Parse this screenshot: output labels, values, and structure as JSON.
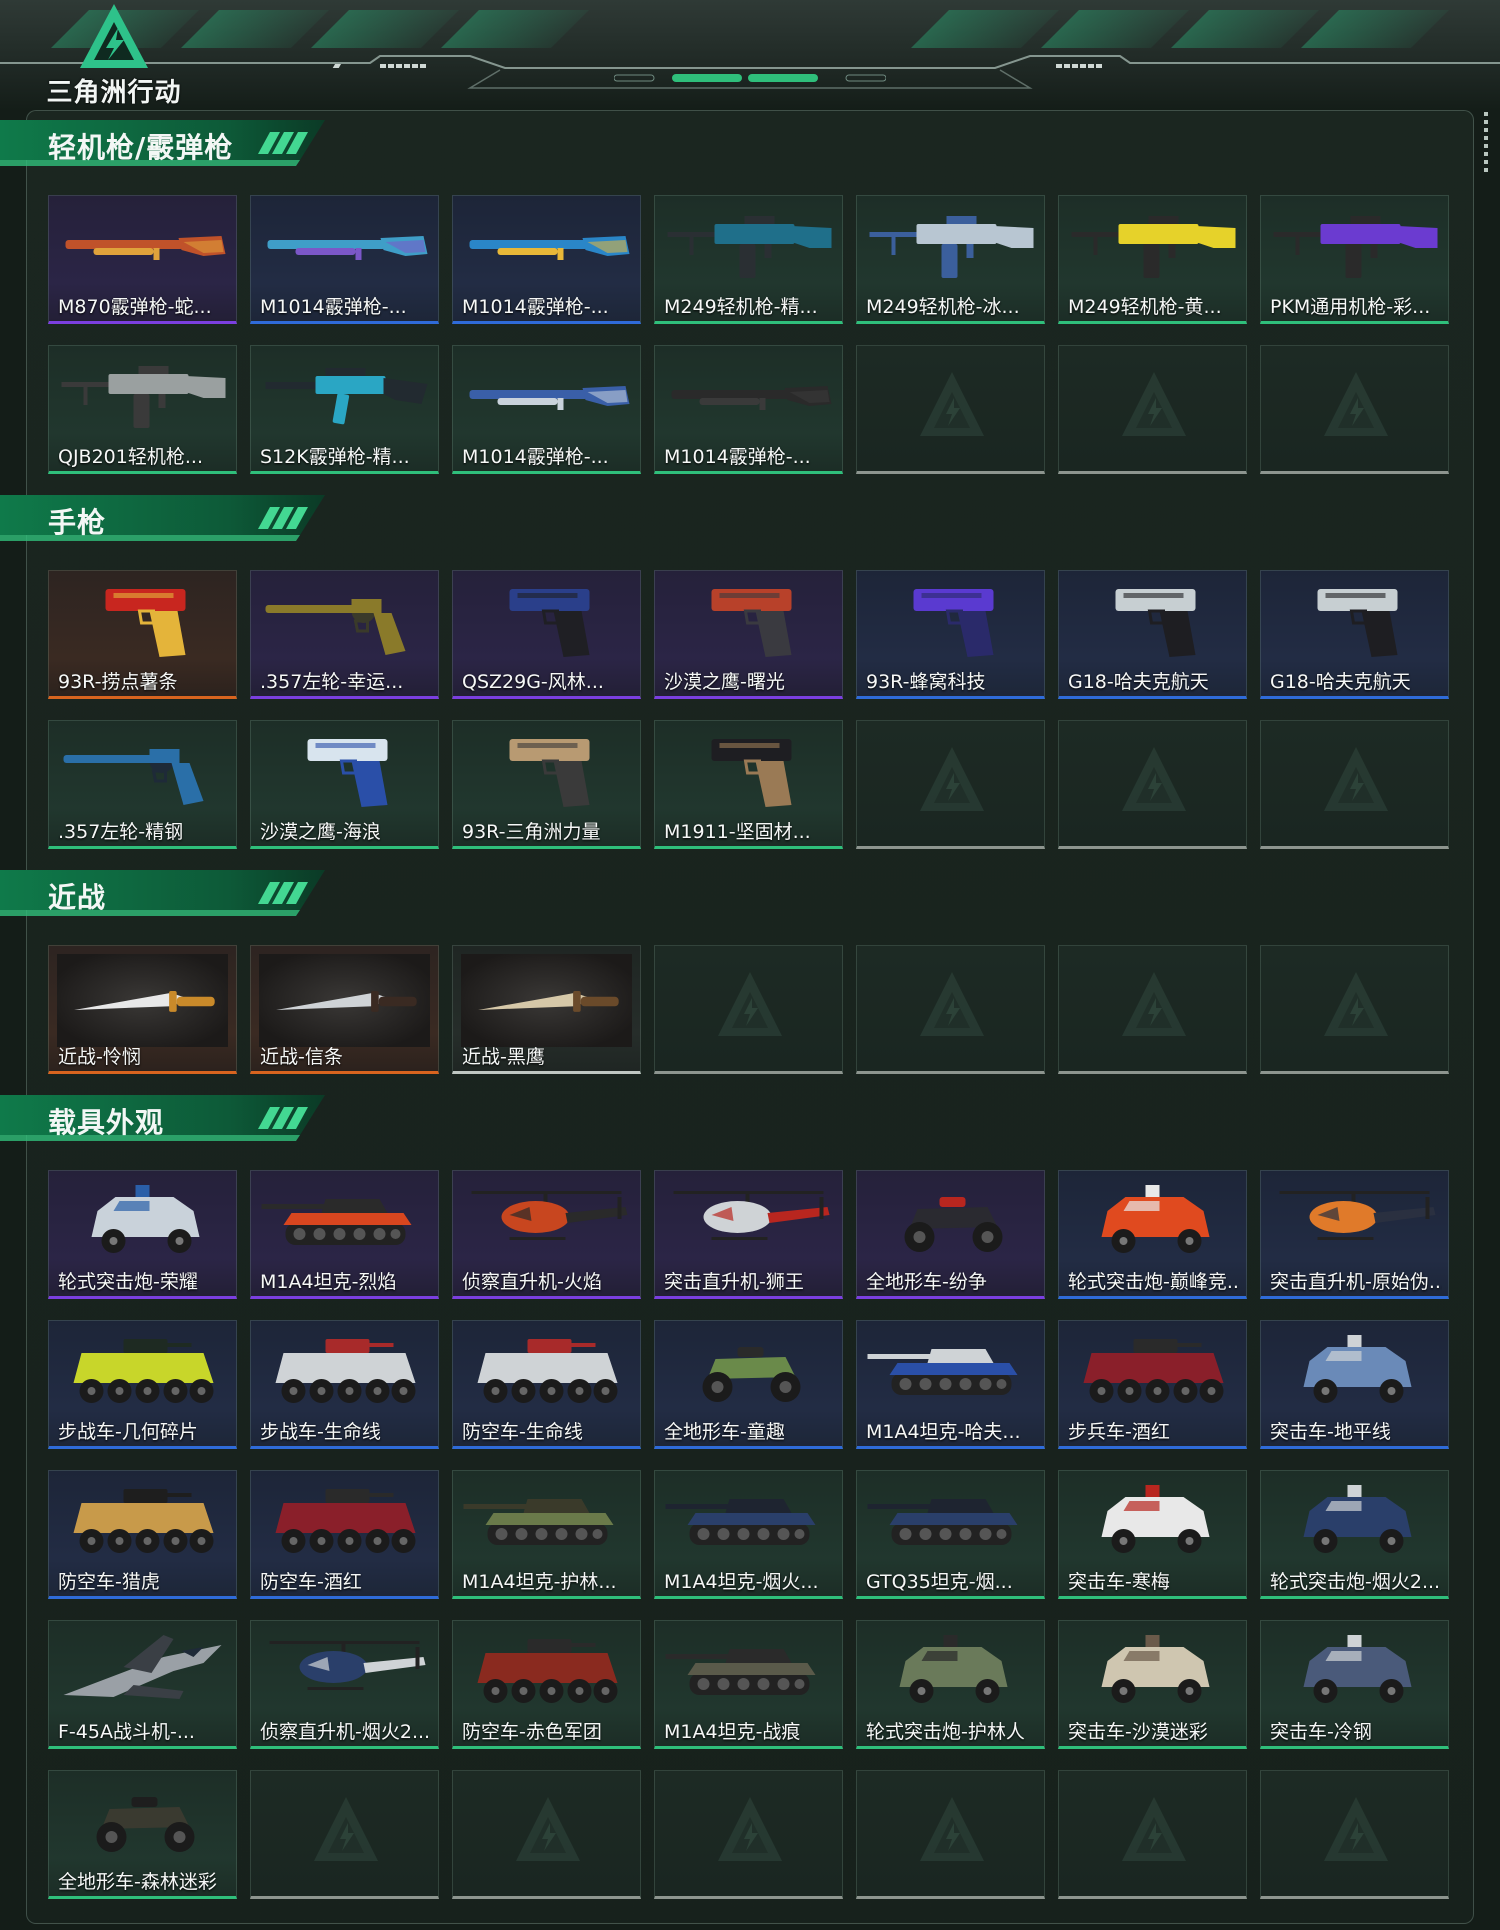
{
  "header": {
    "logo_text": "三角洲行动"
  },
  "sections": [
    {
      "title": "轻机枪/霰弹枪",
      "items": [
        {
          "name": "M870霰弹枪-蛇...",
          "rarity": "purple",
          "icon": "shotgun-icon",
          "colors": [
            "#c0522a",
            "#e0a23b"
          ]
        },
        {
          "name": "M1014霰弹枪-...",
          "rarity": "blue",
          "icon": "shotgun-icon",
          "colors": [
            "#3f9ec8",
            "#7b57c8"
          ]
        },
        {
          "name": "M1014霰弹枪-...",
          "rarity": "blue",
          "icon": "shotgun-icon",
          "colors": [
            "#2a86c8",
            "#e8b838"
          ]
        },
        {
          "name": "M249轻机枪-精...",
          "rarity": "green",
          "icon": "machine-gun-icon",
          "colors": [
            "#1f6f8a",
            "#2a2f33"
          ]
        },
        {
          "name": "M249轻机枪-冰...",
          "rarity": "green",
          "icon": "machine-gun-icon",
          "colors": [
            "#b8c6d2",
            "#3b5f9c"
          ]
        },
        {
          "name": "M249轻机枪-黄...",
          "rarity": "green",
          "icon": "machine-gun-icon",
          "colors": [
            "#e6d22a",
            "#2a2a2a"
          ]
        },
        {
          "name": "PKM通用机枪-彩...",
          "rarity": "green",
          "icon": "machine-gun-icon",
          "colors": [
            "#6b3bd0",
            "#2a2a2a"
          ]
        },
        {
          "name": "QJB201轻机枪...",
          "rarity": "green",
          "icon": "machine-gun-icon",
          "colors": [
            "#9aa0a0",
            "#3a3a3a"
          ]
        },
        {
          "name": "S12K霰弹枪-精...",
          "rarity": "green",
          "icon": "rifle-icon",
          "colors": [
            "#2aa6c4",
            "#222a30"
          ]
        },
        {
          "name": "M1014霰弹枪-...",
          "rarity": "green",
          "icon": "shotgun-icon",
          "colors": [
            "#3a5fa8",
            "#c9d2dc"
          ]
        },
        {
          "name": "M1014霰弹枪-...",
          "rarity": "green",
          "icon": "shotgun-icon",
          "colors": [
            "#2a2a2a",
            "#3a3a3a"
          ]
        },
        {
          "name": "",
          "rarity": "empty"
        },
        {
          "name": "",
          "rarity": "empty"
        },
        {
          "name": "",
          "rarity": "empty"
        }
      ]
    },
    {
      "title": "手枪",
      "items": [
        {
          "name": "93R-捞点薯条",
          "rarity": "orange",
          "icon": "pistol-icon",
          "colors": [
            "#c8261f",
            "#e4b43a"
          ]
        },
        {
          "name": ".357左轮-幸运...",
          "rarity": "purple",
          "icon": "revolver-icon",
          "colors": [
            "#8a7a2a",
            "#3a3a2a"
          ]
        },
        {
          "name": "QSZ29G-风林...",
          "rarity": "purple",
          "icon": "pistol-icon",
          "colors": [
            "#2a3f8a",
            "#1f1f24"
          ]
        },
        {
          "name": "沙漠之鹰-曙光",
          "rarity": "purple",
          "icon": "pistol-icon",
          "colors": [
            "#b8412a",
            "#3a3a40"
          ]
        },
        {
          "name": "93R-蜂窝科技",
          "rarity": "blue",
          "icon": "pistol-icon",
          "colors": [
            "#5a3ad0",
            "#2a2a6a"
          ]
        },
        {
          "name": "G18-哈夫克航天",
          "rarity": "blue",
          "icon": "pistol-icon",
          "colors": [
            "#c7cfd2",
            "#1e1e22"
          ]
        },
        {
          "name": "G18-哈夫克航天",
          "rarity": "blue",
          "icon": "pistol-icon",
          "colors": [
            "#c7cfd2",
            "#1e1e22"
          ]
        },
        {
          "name": ".357左轮-精钢",
          "rarity": "green",
          "icon": "revolver-icon",
          "colors": [
            "#2a6fa8",
            "#1e2a38"
          ]
        },
        {
          "name": "沙漠之鹰-海浪",
          "rarity": "green",
          "icon": "pistol-icon",
          "colors": [
            "#d8e4ee",
            "#2a4fa8"
          ]
        },
        {
          "name": "93R-三角洲力量",
          "rarity": "green",
          "icon": "pistol-icon",
          "colors": [
            "#b89a72",
            "#3a3a3a"
          ]
        },
        {
          "name": "M1911-坚固材...",
          "rarity": "green",
          "icon": "pistol-icon",
          "colors": [
            "#1e1e22",
            "#9a7a55"
          ]
        },
        {
          "name": "",
          "rarity": "empty"
        },
        {
          "name": "",
          "rarity": "empty"
        },
        {
          "name": "",
          "rarity": "empty"
        }
      ]
    },
    {
      "title": "近战",
      "items": [
        {
          "name": "近战-怜悯",
          "rarity": "orange",
          "icon": "knife-icon",
          "colors": [
            "#e8e8e8",
            "#c98a2a"
          ]
        },
        {
          "name": "近战-信条",
          "rarity": "orange",
          "icon": "knife-icon",
          "colors": [
            "#cfd3d6",
            "#3a2a22"
          ]
        },
        {
          "name": "近战-黑鹰",
          "rarity": "white",
          "icon": "knife-icon",
          "colors": [
            "#d6c8a8",
            "#6a4a2a"
          ]
        },
        {
          "name": "",
          "rarity": "empty"
        },
        {
          "name": "",
          "rarity": "empty"
        },
        {
          "name": "",
          "rarity": "empty"
        },
        {
          "name": "",
          "rarity": "empty"
        }
      ]
    },
    {
      "title": "载具外观",
      "items": [
        {
          "name": "轮式突击炮-荣耀",
          "rarity": "purple",
          "icon": "armored-car-icon",
          "colors": [
            "#c9d2da",
            "#2a5fa8"
          ]
        },
        {
          "name": "M1A4坦克-烈焰",
          "rarity": "purple",
          "icon": "tank-icon",
          "colors": [
            "#d8461f",
            "#2a2a2a"
          ]
        },
        {
          "name": "侦察直升机-火焰",
          "rarity": "purple",
          "icon": "helicopter-icon",
          "colors": [
            "#c8461f",
            "#2a2a2a"
          ]
        },
        {
          "name": "突击直升机-狮王",
          "rarity": "purple",
          "icon": "helicopter-icon",
          "colors": [
            "#cfd3d6",
            "#b8261f"
          ]
        },
        {
          "name": "全地形车-纷争",
          "rarity": "purple",
          "icon": "atv-icon",
          "colors": [
            "#2a2a30",
            "#b8261f"
          ]
        },
        {
          "name": "轮式突击炮-巅峰竞...",
          "rarity": "blue",
          "icon": "armored-car-icon",
          "colors": [
            "#e04a1f",
            "#e8e8e8"
          ]
        },
        {
          "name": "突击直升机-原始伪...",
          "rarity": "blue",
          "icon": "helicopter-icon",
          "colors": [
            "#e07a2a",
            "#2a3040"
          ]
        },
        {
          "name": "步战车-几何碎片",
          "rarity": "blue",
          "icon": "ifv-icon",
          "colors": [
            "#c8d62a",
            "#1e2a22"
          ]
        },
        {
          "name": "步战车-生命线",
          "rarity": "blue",
          "icon": "ifv-icon",
          "colors": [
            "#cfd3d6",
            "#a82a2a"
          ]
        },
        {
          "name": "防空车-生命线",
          "rarity": "blue",
          "icon": "ifv-icon",
          "colors": [
            "#cfd3d6",
            "#a82a2a"
          ]
        },
        {
          "name": "全地形车-童趣",
          "rarity": "blue",
          "icon": "atv-icon",
          "colors": [
            "#6a8a4a",
            "#2a2a2a"
          ]
        },
        {
          "name": "M1A4坦克-哈夫...",
          "rarity": "blue",
          "icon": "tank-icon",
          "colors": [
            "#2a4fa8",
            "#cfd3d6"
          ]
        },
        {
          "name": "步兵车-酒红",
          "rarity": "blue",
          "icon": "ifv-icon",
          "colors": [
            "#8a1f2a",
            "#2a2a2a"
          ]
        },
        {
          "name": "突击车-地平线",
          "rarity": "blue",
          "icon": "armored-car-icon",
          "colors": [
            "#6a8ab8",
            "#cfd3d6"
          ]
        },
        {
          "name": "防空车-猎虎",
          "rarity": "blue",
          "icon": "ifv-icon",
          "colors": [
            "#c89a4a",
            "#1e1e1e"
          ]
        },
        {
          "name": "防空车-酒红",
          "rarity": "blue",
          "icon": "ifv-icon",
          "colors": [
            "#8a1f2a",
            "#2a2a2a"
          ]
        },
        {
          "name": "M1A4坦克-护林...",
          "rarity": "green",
          "icon": "tank-icon",
          "colors": [
            "#6a7a4a",
            "#3a3a2a"
          ]
        },
        {
          "name": "M1A4坦克-烟火...",
          "rarity": "green",
          "icon": "tank-icon",
          "colors": [
            "#2a3f6a",
            "#1e2430"
          ]
        },
        {
          "name": "GTQ35坦克-烟...",
          "rarity": "green",
          "icon": "tank-icon",
          "colors": [
            "#2a3f6a",
            "#1e2430"
          ]
        },
        {
          "name": "突击车-寒梅",
          "rarity": "green",
          "icon": "armored-car-icon",
          "colors": [
            "#e8e8e8",
            "#b8261f"
          ]
        },
        {
          "name": "轮式突击炮-烟火2...",
          "rarity": "green",
          "icon": "armored-car-icon",
          "colors": [
            "#2a3f6a",
            "#cfd3d6"
          ]
        },
        {
          "name": "F-45A战斗机-...",
          "rarity": "green",
          "icon": "jet-icon",
          "colors": [
            "#9aa0a6",
            "#3a3f45"
          ]
        },
        {
          "name": "侦察直升机-烟火2...",
          "rarity": "green",
          "icon": "helicopter-icon",
          "colors": [
            "#2a3f6a",
            "#cfd3d6"
          ]
        },
        {
          "name": "防空车-赤色军团",
          "rarity": "green",
          "icon": "ifv-icon",
          "colors": [
            "#8a2a1f",
            "#2a2a2a"
          ]
        },
        {
          "name": "M1A4坦克-战痕",
          "rarity": "green",
          "icon": "tank-icon",
          "colors": [
            "#5a5a4a",
            "#2a2a2a"
          ]
        },
        {
          "name": "轮式突击炮-护林人",
          "rarity": "green",
          "icon": "armored-car-icon",
          "colors": [
            "#6a7a5a",
            "#2a2a2a"
          ]
        },
        {
          "name": "突击车-沙漠迷彩",
          "rarity": "green",
          "icon": "armored-car-icon",
          "colors": [
            "#cfc6b0",
            "#6a5a4a"
          ]
        },
        {
          "name": "突击车-冷钢",
          "rarity": "green",
          "icon": "armored-car-icon",
          "colors": [
            "#4a5a7a",
            "#cfd3d6"
          ]
        },
        {
          "name": "全地形车-森林迷彩",
          "rarity": "green",
          "icon": "atv-icon",
          "colors": [
            "#3a3a30",
            "#1e1e1e"
          ]
        },
        {
          "name": "",
          "rarity": "empty"
        },
        {
          "name": "",
          "rarity": "empty"
        },
        {
          "name": "",
          "rarity": "empty"
        },
        {
          "name": "",
          "rarity": "empty"
        },
        {
          "name": "",
          "rarity": "empty"
        },
        {
          "name": "",
          "rarity": "empty"
        }
      ]
    }
  ],
  "colors": {
    "accent": "#2fbf7b",
    "rarity_green": "#2fbf7b",
    "rarity_blue": "#2f6bd9",
    "rarity_purple": "#7b3fe0",
    "rarity_orange": "#d8641f",
    "rarity_white": "#bfc7c2"
  }
}
